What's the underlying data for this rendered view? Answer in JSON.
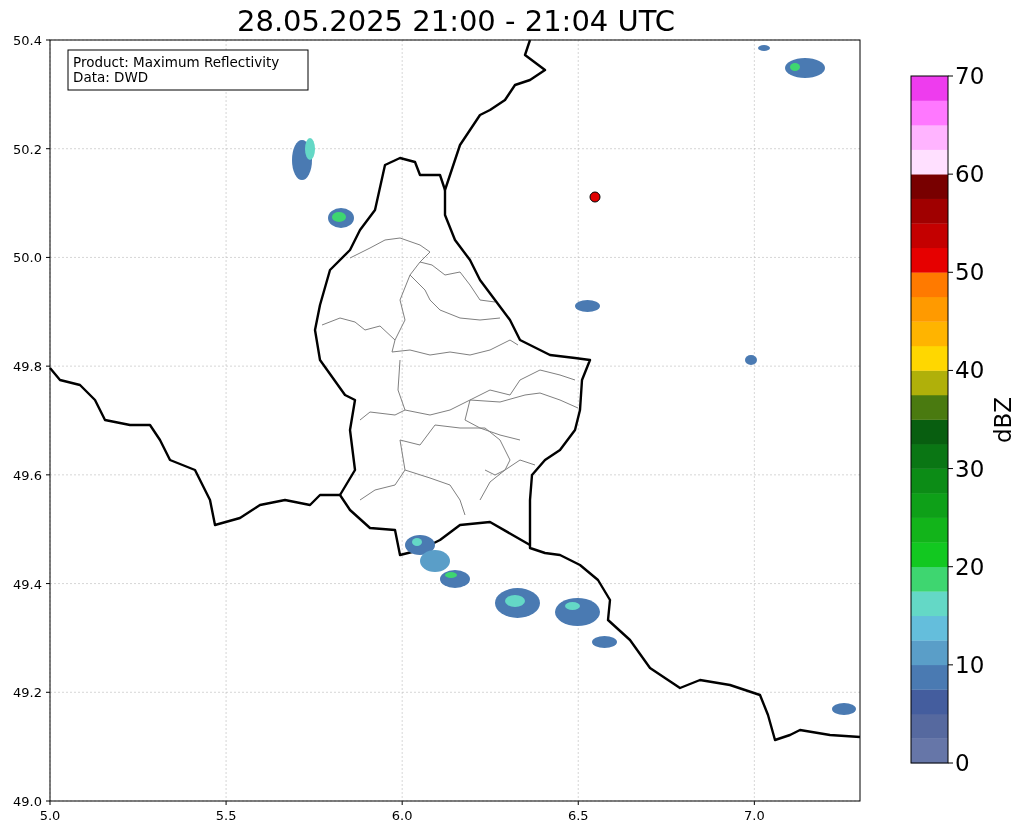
{
  "title": "28.05.2025 21:00 - 21:04 UTC",
  "info_box": [
    "Product: Maximum Reflectivity",
    "Data: DWD"
  ],
  "x_ticks": [
    "5.0",
    "5.5",
    "6.0",
    "6.5",
    "7.0"
  ],
  "y_ticks": [
    "50.4",
    "50.2",
    "50.0",
    "49.8",
    "49.6",
    "49.4",
    "49.2",
    "49.0"
  ],
  "colorbar": {
    "label": "dBZ",
    "ticks": [
      "70",
      "60",
      "50",
      "40",
      "30",
      "20",
      "10",
      "0"
    ],
    "segments": [
      {
        "color": "#6676a8"
      },
      {
        "color": "#56699f"
      },
      {
        "color": "#445d9e"
      },
      {
        "color": "#4a7ab2"
      },
      {
        "color": "#5a9ec8"
      },
      {
        "color": "#64bedc"
      },
      {
        "color": "#64d8c6"
      },
      {
        "color": "#3ed670"
      },
      {
        "color": "#12c820"
      },
      {
        "color": "#12b41a"
      },
      {
        "color": "#0ea018"
      },
      {
        "color": "#0c8c16"
      },
      {
        "color": "#0a7614"
      },
      {
        "color": "#085e10"
      },
      {
        "color": "#4a7a10"
      },
      {
        "color": "#b0b00a"
      },
      {
        "color": "#ffd700"
      },
      {
        "color": "#ffb400"
      },
      {
        "color": "#ff9a00"
      },
      {
        "color": "#ff7a00"
      },
      {
        "color": "#e60000"
      },
      {
        "color": "#c40000"
      },
      {
        "color": "#a00000"
      },
      {
        "color": "#780000"
      },
      {
        "color": "#ffe0ff"
      },
      {
        "color": "#ffb4ff"
      },
      {
        "color": "#ff78ff"
      },
      {
        "color": "#ee3cee"
      }
    ]
  }
}
